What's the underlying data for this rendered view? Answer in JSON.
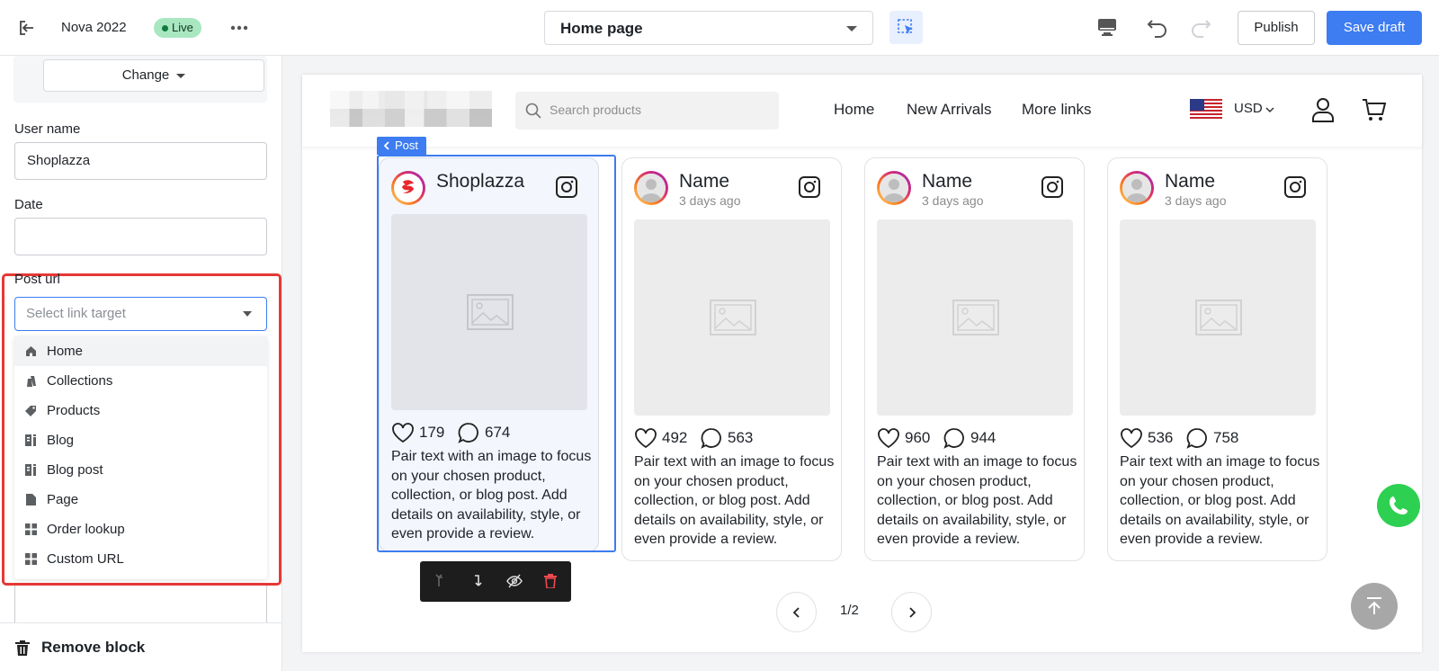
{
  "topbar": {
    "store_name": "Nova 2022",
    "status_badge": "Live",
    "page_selector": "Home page",
    "publish_label": "Publish",
    "save_draft_label": "Save draft"
  },
  "left_panel": {
    "change_label": "Change",
    "user_name_label": "User name",
    "user_name_value": "Shoplazza",
    "date_label": "Date",
    "date_value": "",
    "post_url_label": "Post url",
    "post_url_placeholder": "Select link target",
    "link_targets": [
      {
        "label": "Home",
        "icon": "home-icon"
      },
      {
        "label": "Collections",
        "icon": "collections-icon"
      },
      {
        "label": "Products",
        "icon": "tag-icon"
      },
      {
        "label": "Blog",
        "icon": "blog-icon"
      },
      {
        "label": "Blog post",
        "icon": "blog-post-icon"
      },
      {
        "label": "Page",
        "icon": "page-icon"
      },
      {
        "label": "Order lookup",
        "icon": "grid-icon"
      },
      {
        "label": "Custom URL",
        "icon": "grid-icon"
      }
    ],
    "remove_block_label": "Remove block"
  },
  "store": {
    "search_placeholder": "Search products",
    "nav_links": [
      "Home",
      "New Arrivals",
      "More links"
    ],
    "currency": "USD",
    "post_tag": "Post",
    "cards": [
      {
        "name": "Shoplazza",
        "time": "",
        "likes": "179",
        "comments": "674",
        "text": "Pair text with an image to focus on your chosen product, collection, or blog post. Add details on availability, style, or even provide a review."
      },
      {
        "name": "Name",
        "time": "3 days ago",
        "likes": "492",
        "comments": "563",
        "text": "Pair text with an image to focus on your chosen product, collection, or blog post. Add details on availability, style, or even provide a review."
      },
      {
        "name": "Name",
        "time": "3 days ago",
        "likes": "960",
        "comments": "944",
        "text": "Pair text with an image to focus on your chosen product, collection, or blog post. Add details on availability, style, or even provide a review."
      },
      {
        "name": "Name",
        "time": "3 days ago",
        "likes": "536",
        "comments": "758",
        "text": "Pair text with an image to focus on your chosen product, collection, or blog post. Add details on availability, style, or even provide a review."
      }
    ],
    "pagination": "1/2"
  },
  "colors": {
    "accent": "#3d7cf1",
    "live_badge": "#a9e7c1",
    "highlight_border": "#e53935",
    "whatsapp": "#2ed052"
  }
}
